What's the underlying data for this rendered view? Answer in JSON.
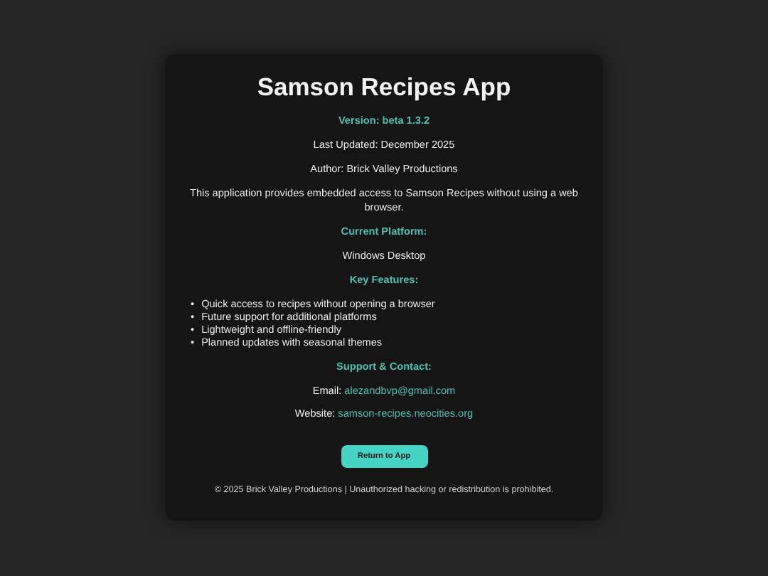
{
  "title": "Samson Recipes App",
  "version": "Version: beta 1.3.2",
  "last_updated": "Last Updated: December 2025",
  "author": "Author: Brick Valley Productions",
  "description": "This application provides embedded access to Samson Recipes without using a web browser.",
  "platform_heading": "Current Platform:",
  "platform": "Windows Desktop",
  "features_heading": "Key Features:",
  "features": [
    {
      "marker": "•",
      "text": "Quick access to recipes without opening a browser"
    },
    {
      "marker": "•",
      "text": "Future support for additional platforms"
    },
    {
      "marker": "•",
      "text": "Lightweight and offline-friendly"
    },
    {
      "marker": "•",
      "text": "Planned updates with seasonal themes"
    }
  ],
  "support_heading": "Support & Contact:",
  "contacts": [
    {
      "label": "Email:",
      "link": "alezandbvp@gmail.com"
    },
    {
      "label": "Website:",
      "link": "samson-recipes.neocities.org"
    }
  ],
  "button": "Return to App",
  "footer": "© 2025 Brick Valley Productions | Unauthorized hacking or redistribution is prohibited."
}
